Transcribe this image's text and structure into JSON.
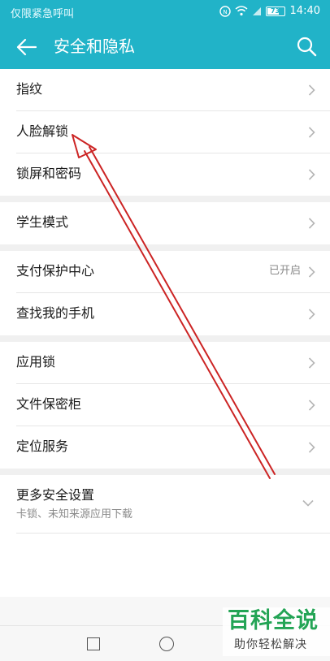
{
  "status_bar": {
    "carrier": "仅限紧急呼叫",
    "battery": "73",
    "battery_level": 0.73,
    "time": "14:40"
  },
  "header": {
    "title": "安全和隐私",
    "back_icon": "arrow-left-icon",
    "search_icon": "search-icon"
  },
  "settings": {
    "group1": [
      {
        "label": "指纹"
      },
      {
        "label": "人脸解锁"
      },
      {
        "label": "锁屏和密码"
      }
    ],
    "group2": [
      {
        "label": "学生模式"
      }
    ],
    "group3": [
      {
        "label": "支付保护中心",
        "value": "已开启"
      },
      {
        "label": "查找我的手机"
      }
    ],
    "group4": [
      {
        "label": "应用锁"
      },
      {
        "label": "文件保密柜"
      },
      {
        "label": "定位服务"
      }
    ],
    "more": {
      "label": "更多安全设置",
      "subtitle": "卡锁、未知来源应用下载"
    }
  },
  "watermark": {
    "main": "百科全说",
    "sub": "助你轻松解决"
  },
  "colors": {
    "header_bg": "#21b3c8",
    "annotation_arrow": "#cc2424",
    "watermark_green": "#23a455"
  }
}
